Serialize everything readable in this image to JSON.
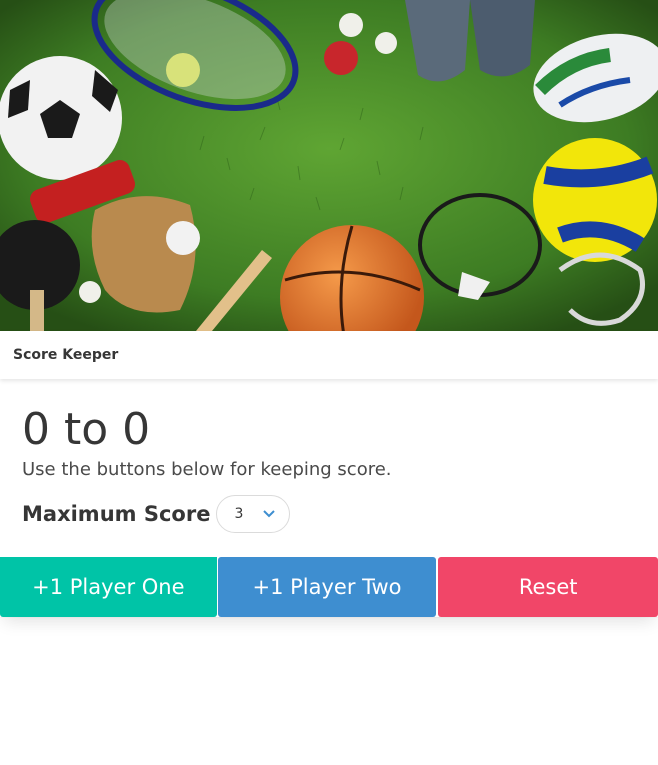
{
  "header": {
    "title": "Score Keeper"
  },
  "score": {
    "display": "0 to 0",
    "instructions": "Use the buttons below for keeping score."
  },
  "max_score": {
    "label": "Maximum Score",
    "selected": "3"
  },
  "buttons": {
    "player_one": "+1 Player One",
    "player_two": "+1 Player Two",
    "reset": "Reset"
  },
  "colors": {
    "player_one": "#00c4a7",
    "player_two": "#3e8ed0",
    "reset": "#f14668"
  }
}
